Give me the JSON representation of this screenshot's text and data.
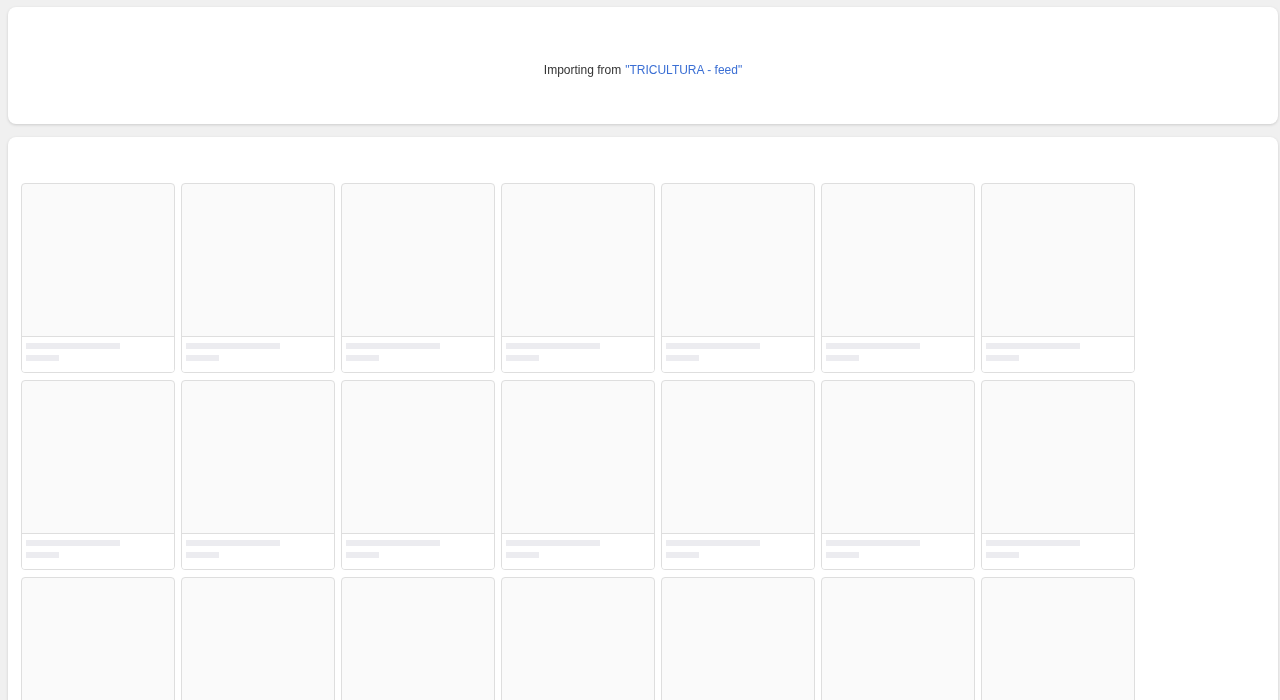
{
  "import_banner": {
    "label": "Importing from",
    "source": "\"TRICULTURA - feed\""
  },
  "cards": [
    {
      "kind": "skeleton"
    },
    {
      "kind": "skeleton"
    },
    {
      "kind": "skeleton"
    },
    {
      "kind": "skeleton"
    },
    {
      "kind": "skeleton"
    },
    {
      "kind": "skeleton"
    },
    {
      "kind": "skeleton"
    },
    {
      "kind": "skeleton"
    },
    {
      "kind": "skeleton"
    },
    {
      "kind": "skeleton"
    },
    {
      "kind": "skeleton"
    },
    {
      "kind": "skeleton"
    },
    {
      "kind": "skeleton"
    },
    {
      "kind": "skeleton"
    },
    {
      "kind": "skeleton"
    },
    {
      "kind": "skeleton"
    },
    {
      "kind": "skeleton"
    },
    {
      "kind": "skeleton"
    },
    {
      "kind": "skeleton"
    },
    {
      "kind": "skeleton"
    },
    {
      "kind": "skeleton"
    }
  ]
}
